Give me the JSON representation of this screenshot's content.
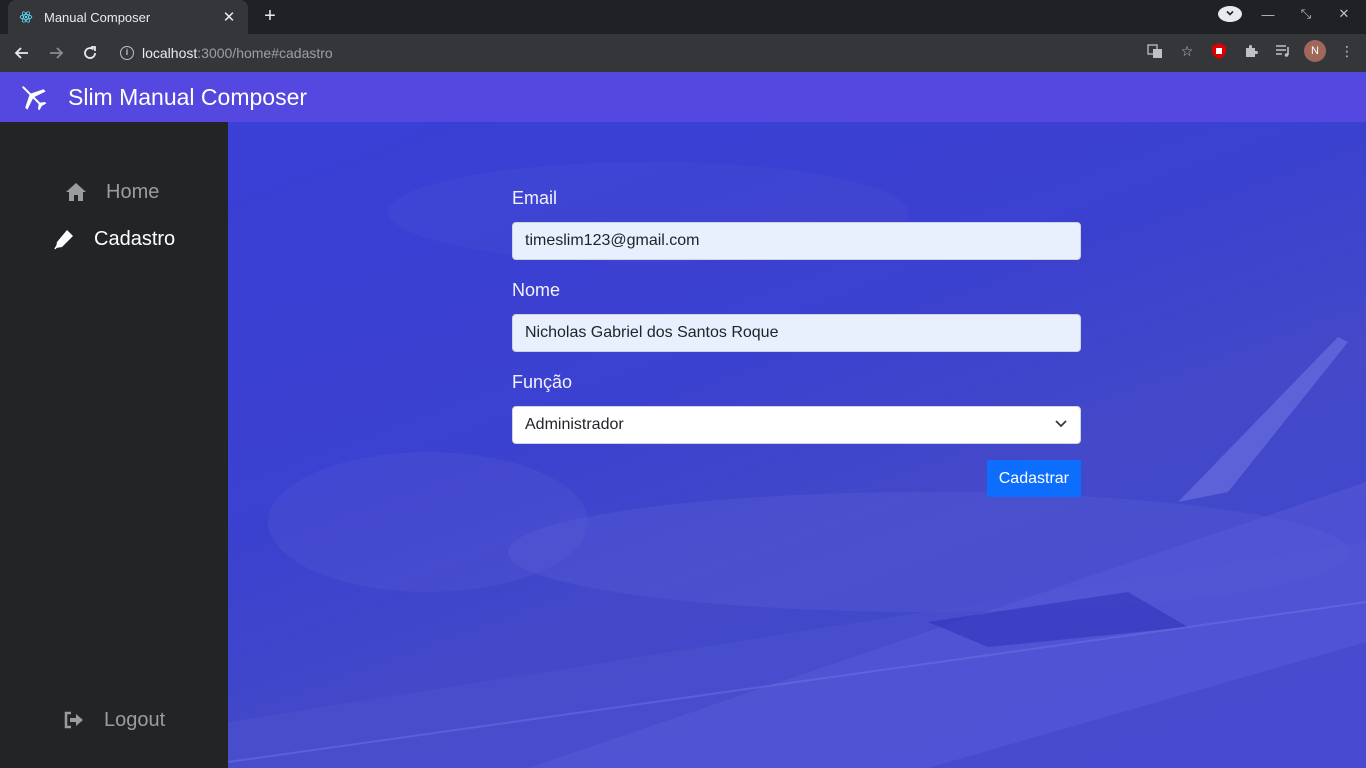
{
  "browser": {
    "tab_title": "Manual Composer",
    "url_host": "localhost",
    "url_path": ":3000/home#cadastro",
    "profile_initial": "N",
    "icons": [
      "back-icon",
      "forward-icon",
      "reload-icon",
      "info-icon",
      "translate-icon",
      "star-icon",
      "extension-shield-icon",
      "puzzle-icon",
      "media-queue-icon",
      "menu-icon"
    ]
  },
  "header": {
    "title": "Slim Manual Composer",
    "logo_icon": "airplane-icon"
  },
  "sidebar": {
    "items": [
      {
        "label": "Home",
        "icon": "home-icon",
        "active": false
      },
      {
        "label": "Cadastro",
        "icon": "pen-icon",
        "active": true
      }
    ],
    "logout": {
      "label": "Logout",
      "icon": "sign-out-icon"
    }
  },
  "form": {
    "email": {
      "label": "Email",
      "value": "timeslim123@gmail.com"
    },
    "nome": {
      "label": "Nome",
      "value": "Nicholas Gabriel dos Santos Roque"
    },
    "funcao": {
      "label": "Função",
      "selected": "Administrador"
    },
    "submit_label": "Cadastrar"
  },
  "colors": {
    "header_bg": "#5448e0",
    "sidebar_bg": "#222426",
    "main_bg": "#3b41cf",
    "button_bg": "#0d6efd"
  }
}
